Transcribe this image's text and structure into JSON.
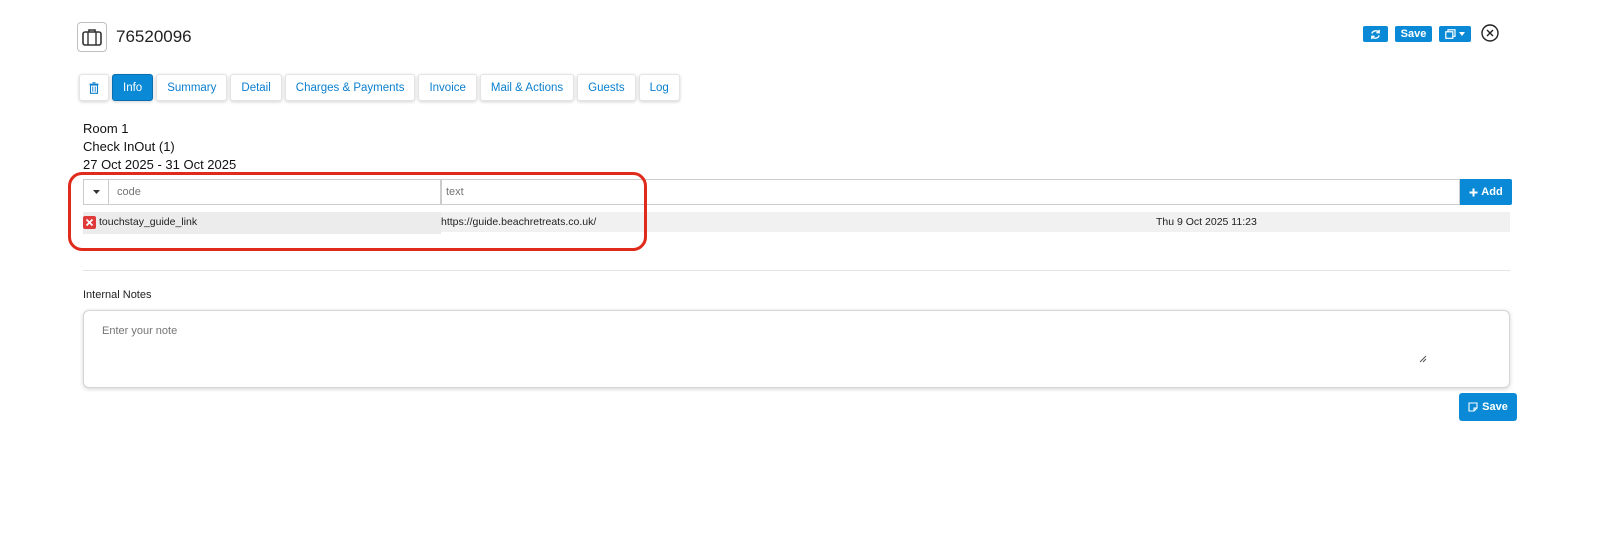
{
  "header": {
    "booking_id": "76520096",
    "booking_icon": "briefcase-icon",
    "buttons": {
      "refresh_icon": "refresh-icon",
      "save_label": "Save",
      "copy_icon": "copy-icon",
      "close_icon": "close-circle-icon"
    }
  },
  "tabs": [
    {
      "label": "",
      "icon": "trash-icon"
    },
    {
      "label": "Info",
      "active": true
    },
    {
      "label": "Summary"
    },
    {
      "label": "Detail"
    },
    {
      "label": "Charges & Payments"
    },
    {
      "label": "Invoice"
    },
    {
      "label": "Mail & Actions"
    },
    {
      "label": "Guests"
    },
    {
      "label": "Log"
    }
  ],
  "room": {
    "name": "Room 1",
    "status": "Check InOut (1)",
    "dates": "27 Oct 2025 - 31 Oct 2025"
  },
  "info_entry": {
    "code_placeholder": "code",
    "text_placeholder": "text",
    "add_label": "Add"
  },
  "info_items": [
    {
      "code": "touchstay_guide_link",
      "value": "https://guide.beachretreats.co.uk/",
      "date": "Thu 9 Oct 2025 11:23"
    }
  ],
  "notes": {
    "label": "Internal Notes",
    "placeholder": "Enter your note",
    "save_label": "Save"
  },
  "colors": {
    "accent": "#0a8ad6",
    "highlight": "#e02a1b",
    "delete": "#e03b3b"
  }
}
